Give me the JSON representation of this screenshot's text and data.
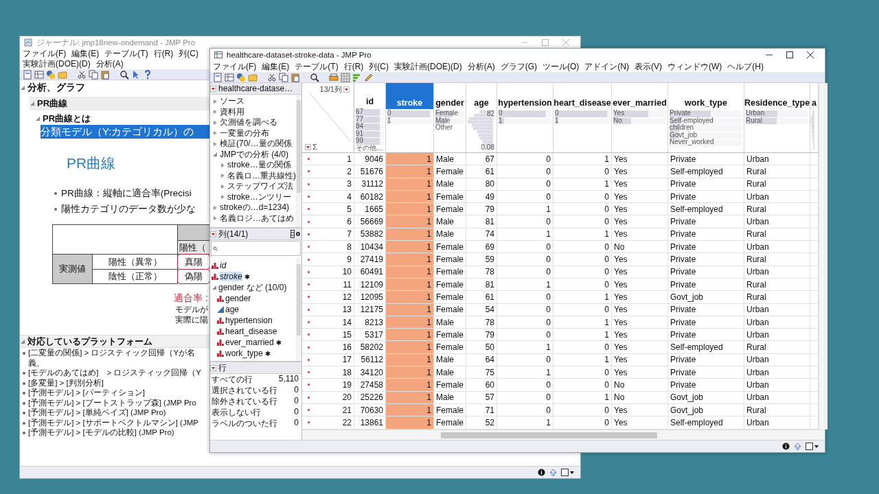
{
  "journal": {
    "title": "ジャーナル: jmp18new-ondemand - JMP Pro",
    "menu": [
      "ファイル(F)",
      "編集(E)",
      "テーブル(T)",
      "行(R)",
      "列(C)",
      "実験計画(DOE)(D)",
      "分析(A)"
    ],
    "outline": [
      {
        "label": "分析、グラフ",
        "expanded": true
      },
      {
        "label": "PR曲線",
        "expanded": true
      },
      {
        "label": "PR曲線とは",
        "expanded": true
      }
    ],
    "selected_line": "分類モデル（Y:カテゴリカル）の",
    "slide": {
      "heading": "PR曲線",
      "bullets": [
        "PR曲線：縦軸に適合率(Precisi",
        "陽性カテゴリのデータ数が少な"
      ],
      "matrix": {
        "column_header": "陽性（",
        "row_header": "実測値",
        "rows": [
          {
            "label": "陽性（異常）",
            "cell": "真陽"
          },
          {
            "label": "陰性（正常）",
            "cell": "偽陽"
          }
        ]
      },
      "formula_label": "適合率 :",
      "notes": [
        "モデルが",
        "実際に陽"
      ]
    },
    "platforms": {
      "title": "対応しているプラットフォーム",
      "expanded": true,
      "items": [
        "[二変量の関係] > ロジスティック回帰（Yが名義、",
        "[モデルのあてはめ]　> ロジスティック回帰（Y",
        "[多変量] > [判別分析]",
        "[予測モデル] > [パーティション]",
        "[予測モデル] > [ブートストラップ森] (JMP Pro",
        "[予測モデル] > [単純ベイズ] (JMP Pro)",
        "[予測モデル] > [サポートベクトルマシン] (JMP",
        "[予測モデル] > [モデルの比較] (JMP Pro)"
      ]
    }
  },
  "data_table": {
    "title": "healthcare-dataset-stroke-data - JMP Pro",
    "menu": [
      "ファイル(F)",
      "編集(E)",
      "テーブル(T)",
      "行(R)",
      "列(C)",
      "実験計画(DOE)(D)",
      "分析(A)",
      "グラフ(G)",
      "ツール(O)",
      "アドイン(N)",
      "表示(V)",
      "ウィンドウ(W)",
      "ヘルプ(H)"
    ],
    "table_panel": {
      "title": "healthcare-datase…",
      "items": [
        {
          "label": "ソース",
          "expanded": false
        },
        {
          "label": "資料用",
          "expanded": false
        },
        {
          "label": "欠測値を調べる",
          "expanded": false
        },
        {
          "label": "一変量の分布",
          "expanded": false
        },
        {
          "label": "検証(70/…量の関係",
          "expanded": false
        },
        {
          "label": "JMPでの分析 (4/0)",
          "expanded": true,
          "children": [
            {
              "label": "stroke…量の関係",
              "expanded": false
            },
            {
              "label": "名義ロ…重共線性)",
              "expanded": false
            },
            {
              "label": "ステップワイズ法",
              "expanded": false
            },
            {
              "label": "stroke…ンツリー",
              "expanded": false
            }
          ]
        },
        {
          "label": "strokeの…d=1234)",
          "expanded": false
        },
        {
          "label": "名義ロジ…あてはめ",
          "expanded": false
        }
      ]
    },
    "columns_panel": {
      "title": "列(14/1)",
      "items": [
        {
          "label": "id",
          "kind": "nominal",
          "italic": true,
          "selected": false
        },
        {
          "label": "stroke",
          "kind": "nominal",
          "italic": true,
          "selected": true,
          "badge": "✱"
        },
        {
          "label": "gender など (10/0)",
          "kind": "group",
          "italic": false,
          "selected": false,
          "expanded": true,
          "children": [
            {
              "label": "gender",
              "kind": "nominal",
              "italic": false,
              "selected": false
            },
            {
              "label": "age",
              "kind": "continuous",
              "italic": false,
              "selected": false
            },
            {
              "label": "hypertension",
              "kind": "nominal",
              "italic": false,
              "selected": false
            },
            {
              "label": "heart_disease",
              "kind": "nominal",
              "italic": false,
              "selected": false
            },
            {
              "label": "ever_married",
              "kind": "nominal",
              "italic": false,
              "selected": false,
              "badge": "✱"
            },
            {
              "label": "work_type",
              "kind": "nominal",
              "italic": false,
              "selected": false,
              "badge": "✱"
            }
          ]
        }
      ]
    },
    "rows_panel": {
      "title": "行",
      "items": [
        {
          "label": "すべての行",
          "value": "5,110"
        },
        {
          "label": "選択されている行",
          "value": "0"
        },
        {
          "label": "除外されている行",
          "value": "0"
        },
        {
          "label": "表示しない行",
          "value": "0"
        },
        {
          "label": "ラベルのついた行",
          "value": "0"
        }
      ]
    },
    "table": {
      "corner": {
        "label": "13/1列",
        "sigma": "Σ"
      },
      "columns": [
        {
          "name": "id",
          "kind": "categorical",
          "selected": false,
          "summary": [
            {
              "label": "67",
              "level": 0.85
            },
            {
              "label": "77",
              "level": 0.85
            },
            {
              "label": "84",
              "level": 0.85
            },
            {
              "label": "91",
              "level": 0.85
            },
            {
              "label": "99",
              "level": 0.85
            },
            {
              "label": "その他…"
            }
          ]
        },
        {
          "name": "stroke",
          "kind": "categorical",
          "selected": true,
          "summary": [
            {
              "label": "0",
              "level": 0.95
            },
            {
              "label": "1",
              "level": 0.05
            }
          ]
        },
        {
          "name": "gender",
          "kind": "categorical",
          "selected": false,
          "summary": [
            {
              "label": "Female",
              "level": 0.6
            },
            {
              "label": "Male",
              "level": 0.4
            },
            {
              "label": "Other"
            }
          ]
        },
        {
          "name": "age",
          "kind": "continuous",
          "selected": false,
          "max": "82",
          "min": "0.08"
        },
        {
          "name": "hypertension",
          "kind": "categorical",
          "selected": false,
          "summary": [
            {
              "label": "0",
              "level": 0.9
            },
            {
              "label": "1",
              "level": 0.1
            }
          ]
        },
        {
          "name": "heart_disease",
          "kind": "categorical",
          "selected": false,
          "summary": [
            {
              "label": "0",
              "level": 0.95
            },
            {
              "label": "1",
              "level": 0.05
            }
          ]
        },
        {
          "name": "ever_married",
          "kind": "categorical",
          "selected": false,
          "summary": [
            {
              "label": "Yes",
              "level": 0.66
            },
            {
              "label": "No",
              "level": 0.34
            }
          ]
        },
        {
          "name": "work_type",
          "kind": "categorical",
          "selected": false,
          "summary": [
            {
              "label": "Private",
              "level": 0.57
            },
            {
              "label": "Self-employed",
              "level": 0.16
            },
            {
              "label": "children",
              "level": 0.13
            },
            {
              "label": "Govt_job",
              "level": 0.13
            },
            {
              "label": "Never_worked",
              "level": 0.01
            }
          ]
        },
        {
          "name": "Residence_type",
          "kind": "categorical",
          "selected": false,
          "summary": [
            {
              "label": "Urban",
              "level": 0.51
            },
            {
              "label": "Rural",
              "level": 0.49
            }
          ]
        },
        {
          "name": "a",
          "kind": "continuous",
          "selected": false
        }
      ],
      "rows": [
        {
          "n": "1",
          "cells": [
            "9046",
            "1",
            "Male",
            "67",
            "0",
            "1",
            "Yes",
            "Private",
            "Urban"
          ]
        },
        {
          "n": "2",
          "cells": [
            "51676",
            "1",
            "Female",
            "61",
            "0",
            "0",
            "Yes",
            "Self-employed",
            "Rural"
          ]
        },
        {
          "n": "3",
          "cells": [
            "31112",
            "1",
            "Male",
            "80",
            "0",
            "1",
            "Yes",
            "Private",
            "Rural"
          ]
        },
        {
          "n": "4",
          "cells": [
            "60182",
            "1",
            "Female",
            "49",
            "0",
            "0",
            "Yes",
            "Private",
            "Urban"
          ]
        },
        {
          "n": "5",
          "cells": [
            "1665",
            "1",
            "Female",
            "79",
            "1",
            "0",
            "Yes",
            "Self-employed",
            "Rural"
          ]
        },
        {
          "n": "6",
          "cells": [
            "56669",
            "1",
            "Male",
            "81",
            "0",
            "0",
            "Yes",
            "Private",
            "Urban"
          ]
        },
        {
          "n": "7",
          "cells": [
            "53882",
            "1",
            "Male",
            "74",
            "1",
            "1",
            "Yes",
            "Private",
            "Rural"
          ]
        },
        {
          "n": "8",
          "cells": [
            "10434",
            "1",
            "Female",
            "69",
            "0",
            "0",
            "No",
            "Private",
            "Urban"
          ]
        },
        {
          "n": "9",
          "cells": [
            "27419",
            "1",
            "Female",
            "59",
            "0",
            "0",
            "Yes",
            "Private",
            "Rural"
          ]
        },
        {
          "n": "10",
          "cells": [
            "60491",
            "1",
            "Female",
            "78",
            "0",
            "0",
            "Yes",
            "Private",
            "Urban"
          ]
        },
        {
          "n": "11",
          "cells": [
            "12109",
            "1",
            "Female",
            "81",
            "1",
            "0",
            "Yes",
            "Private",
            "Rural"
          ]
        },
        {
          "n": "12",
          "cells": [
            "12095",
            "1",
            "Female",
            "61",
            "0",
            "1",
            "Yes",
            "Govt_job",
            "Rural"
          ]
        },
        {
          "n": "13",
          "cells": [
            "12175",
            "1",
            "Female",
            "54",
            "0",
            "0",
            "Yes",
            "Private",
            "Urban"
          ]
        },
        {
          "n": "14",
          "cells": [
            "8213",
            "1",
            "Male",
            "78",
            "0",
            "1",
            "Yes",
            "Private",
            "Urban"
          ]
        },
        {
          "n": "15",
          "cells": [
            "5317",
            "1",
            "Female",
            "79",
            "0",
            "1",
            "Yes",
            "Private",
            "Urban"
          ]
        },
        {
          "n": "16",
          "cells": [
            "58202",
            "1",
            "Female",
            "50",
            "1",
            "0",
            "Yes",
            "Self-employed",
            "Rural"
          ]
        },
        {
          "n": "17",
          "cells": [
            "56112",
            "1",
            "Male",
            "64",
            "0",
            "1",
            "Yes",
            "Private",
            "Urban"
          ]
        },
        {
          "n": "18",
          "cells": [
            "34120",
            "1",
            "Male",
            "75",
            "1",
            "0",
            "Yes",
            "Private",
            "Urban"
          ]
        },
        {
          "n": "19",
          "cells": [
            "27458",
            "1",
            "Female",
            "60",
            "0",
            "0",
            "No",
            "Private",
            "Urban"
          ]
        },
        {
          "n": "20",
          "cells": [
            "25226",
            "1",
            "Male",
            "57",
            "0",
            "1",
            "No",
            "Govt_job",
            "Urban"
          ]
        },
        {
          "n": "21",
          "cells": [
            "70630",
            "1",
            "Female",
            "71",
            "0",
            "0",
            "Yes",
            "Govt_job",
            "Rural"
          ]
        },
        {
          "n": "22",
          "cells": [
            "13861",
            "1",
            "Female",
            "52",
            "1",
            "0",
            "Yes",
            "Self-employed",
            "Urban"
          ]
        }
      ]
    }
  }
}
